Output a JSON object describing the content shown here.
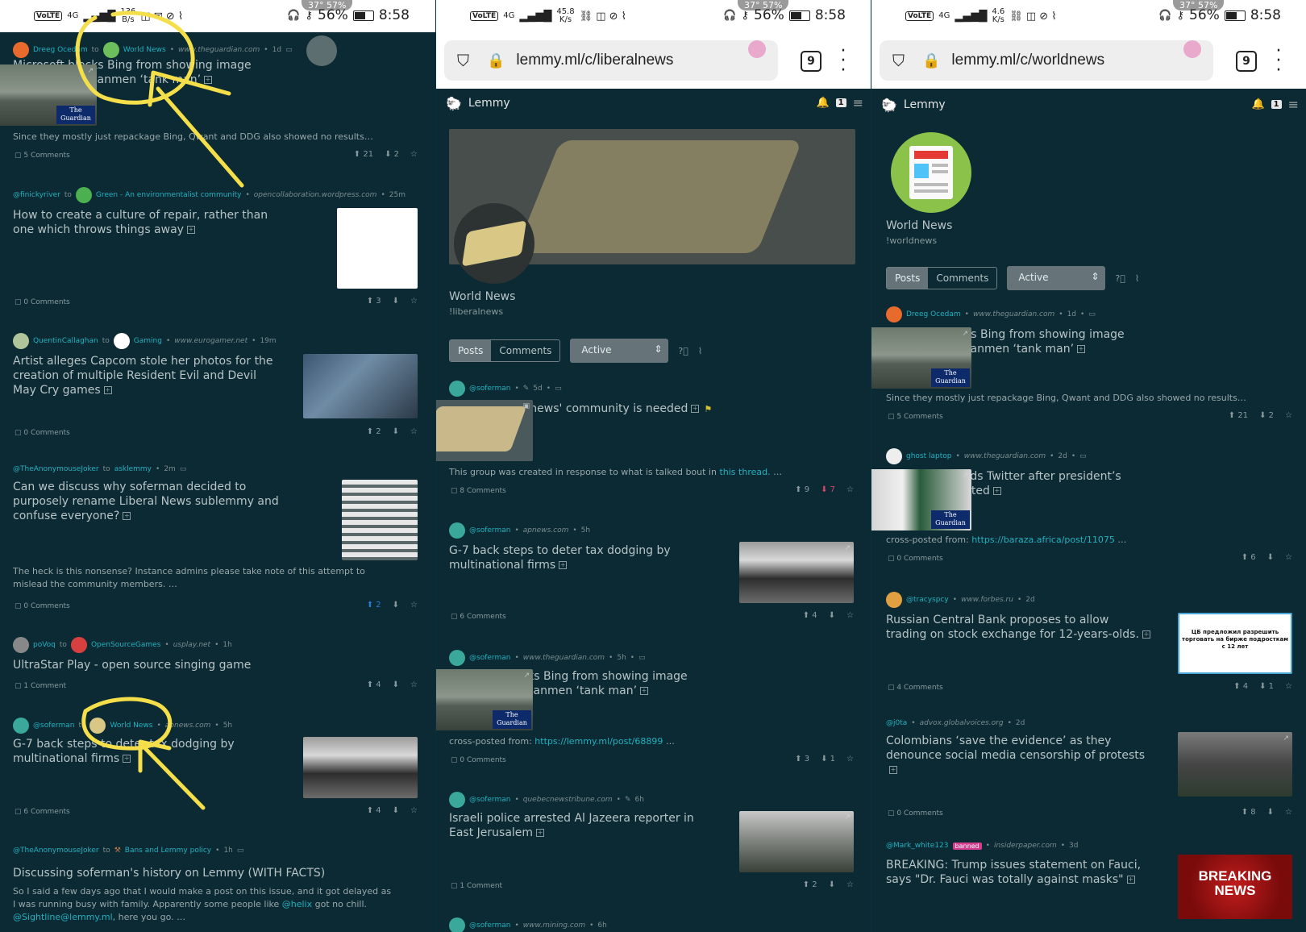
{
  "status_panels": [
    {
      "speed_top": "136",
      "speed_bottom": "B/s",
      "pill": "37°  57%",
      "battery": "56%",
      "time": "8:58"
    },
    {
      "speed_top": "45.8",
      "speed_bottom": "K/s",
      "pill": "37°  57%",
      "battery": "56%",
      "time": "8:58"
    },
    {
      "speed_top": "4.6",
      "speed_bottom": "K/s",
      "pill": "37°  57%",
      "battery": "56%",
      "time": "8:58"
    }
  ],
  "status_common": {
    "volte": "VoLTE",
    "network": "4G"
  },
  "browser": {
    "url2": "lemmy.ml/c/liberalnews",
    "url3": "lemmy.ml/c/worldnews",
    "tab_count": "9"
  },
  "lemmy": {
    "brand": "Lemmy",
    "notif_count": "1"
  },
  "panel1": {
    "posts": [
      {
        "user": "Dreeg Ocedam",
        "to": "to",
        "community": "World News",
        "domain": "www.theguardian.com",
        "age": "1d",
        "title": "Microsoft blocks Bing from showing image results for Tiananmen ‘tank man’",
        "snippet": "Since they mostly just repackage Bing, Qwant and DDG also showed no results…",
        "comments": "5 Comments",
        "up": "21",
        "down": "2"
      },
      {
        "user": "@finickyriver",
        "to": "to",
        "community": "Green - An environmentalist community",
        "domain": "opencollaboration.wordpress.com",
        "age": "25m",
        "title": "How to create a culture of repair, rather than one which throws things away",
        "comments": "0 Comments",
        "up": "3",
        "down": ""
      },
      {
        "user": "QuentinCallaghan",
        "to": "to",
        "community": "Gaming",
        "domain": "www.eurogamer.net",
        "age": "19m",
        "title": "Artist alleges Capcom stole her photos for the creation of multiple Resident Evil and Devil May Cry games",
        "comments": "0 Comments",
        "up": "2",
        "down": ""
      },
      {
        "user": "@TheAnonymouseJoker",
        "to": "to",
        "community": "asklemmy",
        "domain": "",
        "age": "2m",
        "title": "Can we discuss why soferman decided to purposely rename Liberal News sublemmy and confuse everyone?",
        "snippet": "The heck is this nonsense? Instance admins please take note of this attempt to mislead the community members. …",
        "comments": "0 Comments",
        "up": "2",
        "down": ""
      },
      {
        "user": "poVoq",
        "to": "to",
        "community": "OpenSourceGames",
        "domain": "usplay.net",
        "age": "1h",
        "title": "UltraStar Play - open source singing game",
        "comments": "1 Comment",
        "up": "4",
        "down": ""
      },
      {
        "user": "@soferman",
        "to": "to",
        "community": "World News",
        "domain": "apnews.com",
        "age": "5h",
        "title": "G-7 back steps to deter tax dodging by multinational firms",
        "comments": "6 Comments",
        "up": "4",
        "down": ""
      },
      {
        "user": "@TheAnonymouseJoker",
        "to": "to",
        "community": "Bans and Lemmy policy",
        "domain": "",
        "age": "1h",
        "title": "Discussing soferman's history on Lemmy (WITH FACTS)",
        "snippet_a": "So I said a few days ago that I would make a post on this issue, and it got delayed as I was running busy with family. Apparently some people like ",
        "link1": "@helix",
        "snippet_b": " got no chill. ",
        "link2": "@Sightline@lemmy.ml",
        "snippet_c": ", here you go. …"
      }
    ]
  },
  "panel2": {
    "community": {
      "name": "World News",
      "handle": "!liberalnews"
    },
    "tabs": [
      "Posts",
      "Comments"
    ],
    "sort": "Active",
    "posts": [
      {
        "user": "@soferman",
        "domain": "",
        "age": "5d",
        "title": "Why a 'liberal news' community is needed",
        "snippet_a": "This group was created in response to what is talked bout in ",
        "link": "this thread.",
        "snippet_b": " …",
        "comments": "8 Comments",
        "up": "9",
        "down": "7"
      },
      {
        "user": "@soferman",
        "domain": "apnews.com",
        "age": "5h",
        "title": "G-7 back steps to deter tax dodging by multinational firms",
        "comments": "6 Comments",
        "up": "4",
        "down": ""
      },
      {
        "user": "@soferman",
        "domain": "www.theguardian.com",
        "age": "5h",
        "title": "Microsoft blocks Bing from showing image results for Tiananmen ‘tank man’",
        "snippet_a": "cross-posted from: ",
        "link": "https://lemmy.ml/post/68899",
        "snippet_b": " …",
        "comments": "0 Comments",
        "up": "3",
        "down": "1"
      },
      {
        "user": "@soferman",
        "domain": "quebecnewstribune.com",
        "age": "6h",
        "title": "Israeli police arrested Al Jazeera reporter in East Jerusalem",
        "comments": "1 Comment",
        "up": "2",
        "down": ""
      },
      {
        "user": "@soferman",
        "domain": "www.mining.com",
        "age": "6h"
      }
    ]
  },
  "panel3": {
    "community": {
      "name": "World News",
      "handle": "!worldnews"
    },
    "tabs": [
      "Posts",
      "Comments"
    ],
    "sort": "Active",
    "posts": [
      {
        "user": "Dreeg Ocedam",
        "domain": "www.theguardian.com",
        "age": "1d",
        "title": "Microsoft blocks Bing from showing image results for Tiananmen ‘tank man’",
        "snippet": "Since they mostly just repackage Bing, Qwant and DDG also showed no results…",
        "comments": "5 Comments",
        "up": "21",
        "down": "2"
      },
      {
        "user": "ghost laptop",
        "domain": "www.theguardian.com",
        "age": "2d",
        "title": "Nigeria suspends Twitter after president’s tweet was deleted",
        "snippet_a": "cross-posted from: ",
        "link": "https://baraza.africa/post/11075",
        "snippet_b": " …",
        "comments": "0 Comments",
        "up": "6",
        "down": ""
      },
      {
        "user": "@tracyspcy",
        "domain": "www.forbes.ru",
        "age": "2d",
        "title": "Russian Central Bank proposes to allow trading on stock exchange for 12-years-olds.",
        "thumb_text": "ЦБ предложил разрешить торговать на бирже подросткам с 12 лет",
        "comments": "4 Comments",
        "up": "4",
        "down": "1"
      },
      {
        "user": "@j0ta",
        "domain": "advox.globalvoices.org",
        "age": "2d",
        "title": "Colombians ‘save the evidence’ as they denounce social media censorship of protests",
        "comments": "0 Comments",
        "up": "8",
        "down": ""
      },
      {
        "user": "@Mark_white123",
        "badge": "banned",
        "domain": "insiderpaper.com",
        "age": "3d",
        "title": "BREAKING: Trump issues statement on Fauci, says \"Dr. Fauci was totally against masks\"",
        "thumb_text": "BREAKING NEWS"
      }
    ]
  },
  "colors": {
    "bg": "#0b2a33",
    "accent": "#21b0c0",
    "annotation": "#f4de4a"
  },
  "icons": [
    "shield-icon",
    "lock-icon",
    "bell-icon",
    "menu-icon",
    "comment-icon",
    "upvote-icon",
    "downvote-icon",
    "star-icon",
    "expand-icon",
    "external-link-icon",
    "help-icon",
    "rss-icon"
  ]
}
